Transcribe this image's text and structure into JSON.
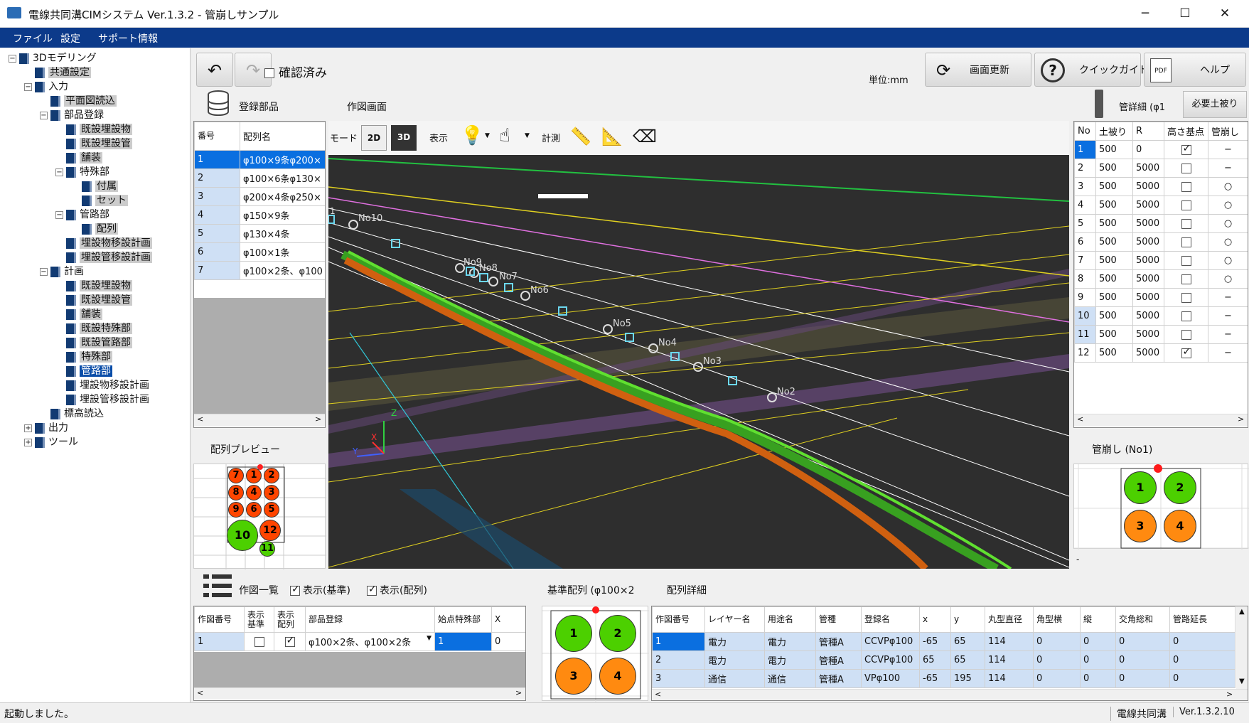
{
  "window": {
    "title": "電線共同溝CIMシステム Ver.1.3.2 - 管崩しサンプル",
    "minimize": "─",
    "maximize": "☐",
    "close": "✕"
  },
  "menu": [
    "ファイル",
    "設定",
    "サポート情報"
  ],
  "tree": [
    {
      "label": "3Dモデリング",
      "indent": 0,
      "expander": "−",
      "style": ""
    },
    {
      "label": "共通設定",
      "indent": 1,
      "expander": "",
      "style": "hi"
    },
    {
      "label": "入力",
      "indent": 1,
      "expander": "−",
      "style": ""
    },
    {
      "label": "平面図読込",
      "indent": 2,
      "expander": "",
      "style": "hi"
    },
    {
      "label": "部品登録",
      "indent": 2,
      "expander": "−",
      "style": ""
    },
    {
      "label": "既設埋設物",
      "indent": 3,
      "expander": "",
      "style": "hi"
    },
    {
      "label": "既設埋設管",
      "indent": 3,
      "expander": "",
      "style": "hi"
    },
    {
      "label": "舗装",
      "indent": 3,
      "expander": "",
      "style": "hi"
    },
    {
      "label": "特殊部",
      "indent": 3,
      "expander": "−",
      "style": ""
    },
    {
      "label": "付属",
      "indent": 4,
      "expander": "",
      "style": "hi"
    },
    {
      "label": "セット",
      "indent": 4,
      "expander": "",
      "style": "hi"
    },
    {
      "label": "管路部",
      "indent": 3,
      "expander": "−",
      "style": ""
    },
    {
      "label": "配列",
      "indent": 4,
      "expander": "",
      "style": "hi"
    },
    {
      "label": "埋設物移設計画",
      "indent": 3,
      "expander": "",
      "style": "hi"
    },
    {
      "label": "埋設管移設計画",
      "indent": 3,
      "expander": "",
      "style": "hi"
    },
    {
      "label": "計画",
      "indent": 2,
      "expander": "−",
      "style": ""
    },
    {
      "label": "既設埋設物",
      "indent": 3,
      "expander": "",
      "style": "hi"
    },
    {
      "label": "既設埋設管",
      "indent": 3,
      "expander": "",
      "style": "hi"
    },
    {
      "label": "舗装",
      "indent": 3,
      "expander": "",
      "style": "hi"
    },
    {
      "label": "既設特殊部",
      "indent": 3,
      "expander": "",
      "style": "hi"
    },
    {
      "label": "既設管路部",
      "indent": 3,
      "expander": "",
      "style": "hi"
    },
    {
      "label": "特殊部",
      "indent": 3,
      "expander": "",
      "style": "hi"
    },
    {
      "label": "管路部",
      "indent": 3,
      "expander": "",
      "style": "sel"
    },
    {
      "label": "埋設物移設計画",
      "indent": 3,
      "expander": "",
      "style": ""
    },
    {
      "label": "埋設管移設計画",
      "indent": 3,
      "expander": "",
      "style": ""
    },
    {
      "label": "標高読込",
      "indent": 2,
      "expander": "",
      "style": ""
    },
    {
      "label": "出力",
      "indent": 1,
      "expander": "+",
      "style": ""
    },
    {
      "label": "ツール",
      "indent": 1,
      "expander": "+",
      "style": ""
    }
  ],
  "toolbar": {
    "undo": "↶",
    "redo": "↷",
    "confirmed": "確認済み",
    "unit": "単位:mm",
    "refresh": "画面更新",
    "quickguide": "クイックガイド",
    "help": "ヘルプ",
    "pdf": "PDF"
  },
  "parts": {
    "label": "登録部品",
    "header_no": "番号",
    "header_name": "配列名",
    "rows": [
      [
        "1",
        "φ100×9条φ200×"
      ],
      [
        "2",
        "φ100×6条φ130×"
      ],
      [
        "3",
        "φ200×4条φ250×"
      ],
      [
        "4",
        "φ150×9条"
      ],
      [
        "5",
        "φ130×4条"
      ],
      [
        "6",
        "φ100×1条"
      ],
      [
        "7",
        "φ100×2条、φ100"
      ]
    ]
  },
  "drawing": {
    "label": "作図画面",
    "mode": "モード",
    "btn2d": "2D",
    "btn3d": "3D",
    "display": "表示",
    "measure": "計測",
    "nodes": [
      "No10",
      "No9",
      "No8",
      "No7",
      "No6",
      "No5",
      "No4",
      "No3",
      "No2"
    ],
    "node_1": "1",
    "axis_z": "Z",
    "axis_x": "X",
    "axis_y": "Y"
  },
  "preview": {
    "label": "配列プレビュー",
    "circles": [
      "7",
      "1",
      "2",
      "8",
      "4",
      "3",
      "9",
      "6",
      "5",
      "10",
      "12",
      "11"
    ]
  },
  "detail": {
    "label": "管詳細 (φ1",
    "required_cover": "必要土被り",
    "headers": [
      "No",
      "土被り",
      "R",
      "高さ基点",
      "管崩し"
    ],
    "rows": [
      [
        "1",
        "500",
        "0",
        true,
        "−"
      ],
      [
        "2",
        "500",
        "5000",
        false,
        "−"
      ],
      [
        "3",
        "500",
        "5000",
        false,
        "○"
      ],
      [
        "4",
        "500",
        "5000",
        false,
        "○"
      ],
      [
        "5",
        "500",
        "5000",
        false,
        "○"
      ],
      [
        "6",
        "500",
        "5000",
        false,
        "○"
      ],
      [
        "7",
        "500",
        "5000",
        false,
        "○"
      ],
      [
        "8",
        "500",
        "5000",
        false,
        "○"
      ],
      [
        "9",
        "500",
        "5000",
        false,
        "−"
      ],
      [
        "10",
        "500",
        "5000",
        false,
        "−"
      ],
      [
        "11",
        "500",
        "5000",
        false,
        "−"
      ],
      [
        "12",
        "500",
        "5000",
        true,
        "−"
      ]
    ]
  },
  "kankuzushi": {
    "label": "管崩し (No1)",
    "circles": [
      "1",
      "2",
      "3",
      "4"
    ],
    "dash": "-"
  },
  "drawlist": {
    "label": "作図一覧",
    "show_base": "表示(基準)",
    "show_array": "表示(配列)",
    "headers": [
      "作図番号",
      "表示基準",
      "表示配列",
      "部品登録",
      "始点特殊部",
      "X"
    ],
    "row": [
      "1",
      "",
      "",
      "φ100×2条、φ100×2条",
      "1",
      "0"
    ]
  },
  "base_array": {
    "label": "基準配列 (φ100×2",
    "circles": [
      "1",
      "2",
      "3",
      "4"
    ]
  },
  "array_detail": {
    "label": "配列詳細",
    "headers": [
      "作図番号",
      "レイヤー名",
      "用途名",
      "管種",
      "登録名",
      "x",
      "y",
      "丸型直径",
      "角型横",
      "縦",
      "交角総和",
      "管路延長"
    ],
    "rows": [
      [
        "1",
        "電力",
        "電力",
        "管種A",
        "CCVPφ100",
        "-65",
        "65",
        "114",
        "0",
        "0",
        "0",
        "0"
      ],
      [
        "2",
        "電力",
        "電力",
        "管種A",
        "CCVPφ100",
        "65",
        "65",
        "114",
        "0",
        "0",
        "0",
        "0"
      ],
      [
        "3",
        "通信",
        "通信",
        "管種A",
        "VPφ100",
        "-65",
        "195",
        "114",
        "0",
        "0",
        "0",
        "0"
      ]
    ]
  },
  "status": {
    "message": "起動しました。",
    "app": "電線共同溝",
    "version": "Ver.1.3.2.10"
  },
  "colors": {
    "menu": "#0c3a8a",
    "selection": "#0a4da8",
    "viewport": "#2e2e2e",
    "red_circle": "#ff4500",
    "green_circle": "#4cd000",
    "orange_circle": "#ff8a10"
  }
}
